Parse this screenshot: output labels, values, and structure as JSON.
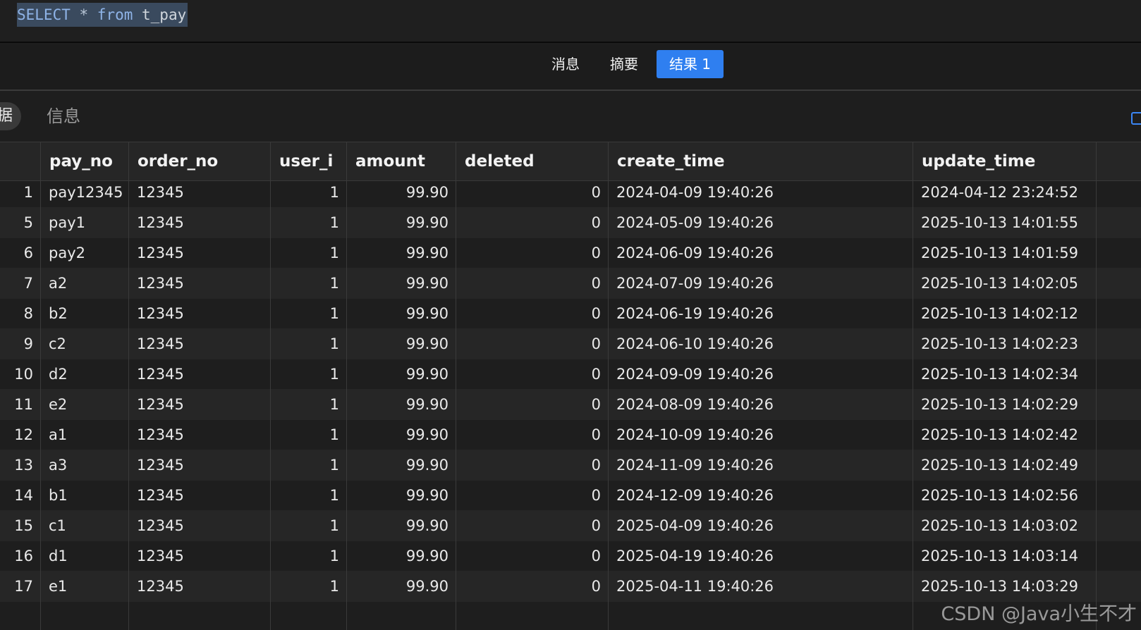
{
  "editor": {
    "sql_keyword": "SELECT",
    "sql_star": " * ",
    "sql_from": "from",
    "sql_table": " t_pay"
  },
  "result_tabs": [
    {
      "label": "消息",
      "active": false
    },
    {
      "label": "摘要",
      "active": false
    },
    {
      "label": "结果 1",
      "active": true
    }
  ],
  "sub_tabs": {
    "data_label": "据",
    "info_label": "信息"
  },
  "table": {
    "columns": [
      "pay_no",
      "order_no",
      "user_i",
      "amount",
      "deleted",
      "create_time",
      "update_time"
    ],
    "rows": [
      {
        "id": "1",
        "pay_no": "pay12345",
        "order_no": "12345",
        "user_id": "1",
        "amount": "99.90",
        "deleted": "0",
        "create_time": "2024-04-09 19:40:26",
        "update_time": "2024-04-12 23:24:52"
      },
      {
        "id": "5",
        "pay_no": "pay1",
        "order_no": "12345",
        "user_id": "1",
        "amount": "99.90",
        "deleted": "0",
        "create_time": "2024-05-09 19:40:26",
        "update_time": "2025-10-13 14:01:55"
      },
      {
        "id": "6",
        "pay_no": "pay2",
        "order_no": "12345",
        "user_id": "1",
        "amount": "99.90",
        "deleted": "0",
        "create_time": "2024-06-09 19:40:26",
        "update_time": "2025-10-13 14:01:59"
      },
      {
        "id": "7",
        "pay_no": "a2",
        "order_no": "12345",
        "user_id": "1",
        "amount": "99.90",
        "deleted": "0",
        "create_time": "2024-07-09 19:40:26",
        "update_time": "2025-10-13 14:02:05"
      },
      {
        "id": "8",
        "pay_no": "b2",
        "order_no": "12345",
        "user_id": "1",
        "amount": "99.90",
        "deleted": "0",
        "create_time": "2024-06-19 19:40:26",
        "update_time": "2025-10-13 14:02:12"
      },
      {
        "id": "9",
        "pay_no": "c2",
        "order_no": "12345",
        "user_id": "1",
        "amount": "99.90",
        "deleted": "0",
        "create_time": "2024-06-10 19:40:26",
        "update_time": "2025-10-13 14:02:23"
      },
      {
        "id": "10",
        "pay_no": "d2",
        "order_no": "12345",
        "user_id": "1",
        "amount": "99.90",
        "deleted": "0",
        "create_time": "2024-09-09 19:40:26",
        "update_time": "2025-10-13 14:02:34"
      },
      {
        "id": "11",
        "pay_no": "e2",
        "order_no": "12345",
        "user_id": "1",
        "amount": "99.90",
        "deleted": "0",
        "create_time": "2024-08-09 19:40:26",
        "update_time": "2025-10-13 14:02:29"
      },
      {
        "id": "12",
        "pay_no": "a1",
        "order_no": "12345",
        "user_id": "1",
        "amount": "99.90",
        "deleted": "0",
        "create_time": "2024-10-09 19:40:26",
        "update_time": "2025-10-13 14:02:42"
      },
      {
        "id": "13",
        "pay_no": "a3",
        "order_no": "12345",
        "user_id": "1",
        "amount": "99.90",
        "deleted": "0",
        "create_time": "2024-11-09 19:40:26",
        "update_time": "2025-10-13 14:02:49"
      },
      {
        "id": "14",
        "pay_no": "b1",
        "order_no": "12345",
        "user_id": "1",
        "amount": "99.90",
        "deleted": "0",
        "create_time": "2024-12-09 19:40:26",
        "update_time": "2025-10-13 14:02:56"
      },
      {
        "id": "15",
        "pay_no": "c1",
        "order_no": "12345",
        "user_id": "1",
        "amount": "99.90",
        "deleted": "0",
        "create_time": "2025-04-09 19:40:26",
        "update_time": "2025-10-13 14:03:02"
      },
      {
        "id": "16",
        "pay_no": "d1",
        "order_no": "12345",
        "user_id": "1",
        "amount": "99.90",
        "deleted": "0",
        "create_time": "2025-04-19 19:40:26",
        "update_time": "2025-10-13 14:03:14"
      },
      {
        "id": "17",
        "pay_no": "e1",
        "order_no": "12345",
        "user_id": "1",
        "amount": "99.90",
        "deleted": "0",
        "create_time": "2025-04-11 19:40:26",
        "update_time": "2025-10-13 14:03:29"
      }
    ]
  },
  "watermark": "CSDN @Java小生不才",
  "colors": {
    "accent": "#2f7ff0",
    "background": "#1e1e1e",
    "row_alt": "#262626"
  }
}
